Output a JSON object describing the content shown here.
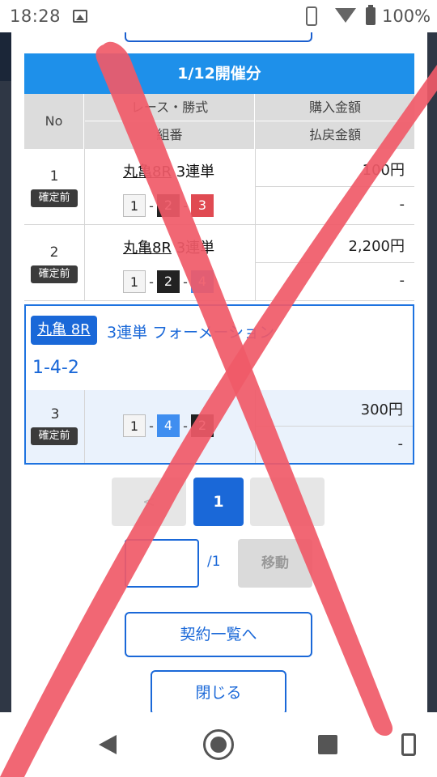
{
  "status_bar": {
    "time": "18:28",
    "battery": "100%"
  },
  "modal": {
    "title": "1/12開催分",
    "headers": {
      "no": "No",
      "race": "レース・勝式",
      "combo": "組番",
      "amount": "購入金額",
      "payout": "払戻金額"
    },
    "rows": [
      {
        "no": "1",
        "status": "確定前",
        "venue": "丸亀8R",
        "bet_type": "3連単",
        "combo": [
          "1",
          "2",
          "3"
        ],
        "amount": "100円",
        "payout": "-"
      },
      {
        "no": "2",
        "status": "確定前",
        "venue": "丸亀8R",
        "bet_type": "3連単",
        "combo": [
          "1",
          "2",
          "4"
        ],
        "amount": "2,200円",
        "payout": "-"
      }
    ],
    "formation": {
      "venue": "丸亀 8R",
      "bet_type": "3連単 フォーメーション",
      "combo_text": "1-4-2",
      "no": "3",
      "status": "確定前",
      "combo": [
        "1",
        "4",
        "2"
      ],
      "amount": "300円",
      "payout": "-"
    },
    "pagination": {
      "prev": "<",
      "current": "1",
      "next": ">",
      "total": "/1",
      "move_label": "移動"
    },
    "buttons": {
      "contract_list": "契約一覧へ",
      "close": "閉じる"
    }
  },
  "colors": {
    "title_bar": "#1e90ea",
    "accent": "#1a68d8",
    "boat_1": "#f4f4f4",
    "boat_2": "#222222",
    "boat_3": "#e04a52",
    "boat_4": "#3f8ef0",
    "badge": "#3b3b3b",
    "cross_overlay": "#f05a68"
  },
  "icons": {
    "status_bar": [
      "image-icon",
      "phone-vibrate-icon",
      "wifi-icon",
      "battery-icon"
    ],
    "nav_bar": [
      "back-icon",
      "home-icon",
      "recents-icon",
      "rotate-icon"
    ]
  }
}
